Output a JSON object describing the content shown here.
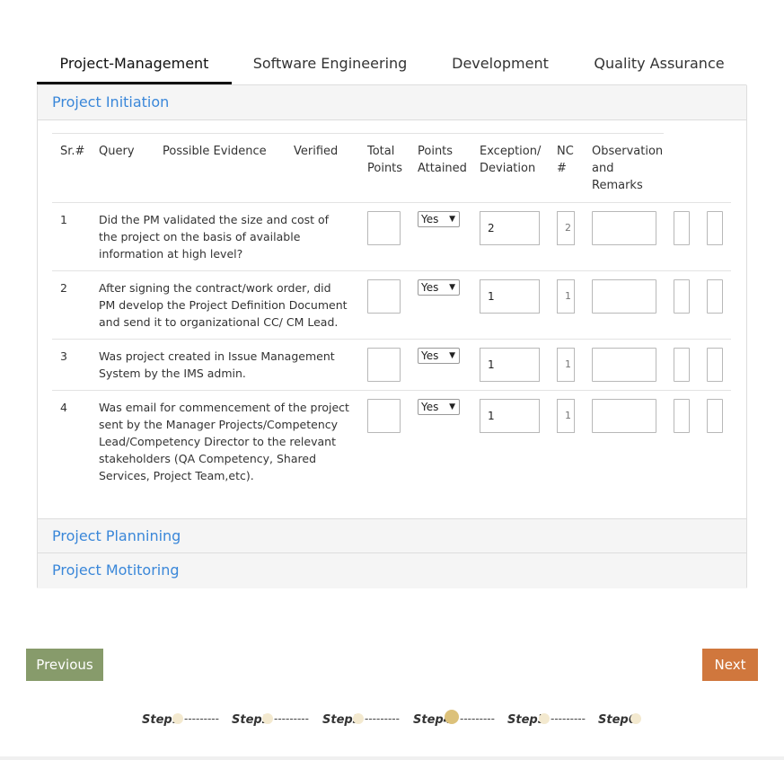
{
  "tabs": [
    "Project-Management",
    "Software Engineering",
    "Development",
    "Quality Assurance"
  ],
  "active_tab": 0,
  "sections": [
    "Project Initiation",
    "Project Plannining",
    "Project Motitoring"
  ],
  "table": {
    "headers": {
      "sr": "Sr.#",
      "query": "Query",
      "evidence": "Possible Evidence",
      "verified": "Verified",
      "total_points": [
        "Total",
        "Points"
      ],
      "points_attained": [
        "Points",
        "Attained"
      ],
      "exception": [
        "Exception/",
        "Deviation"
      ],
      "nc": [
        "NC",
        "#"
      ],
      "observation": [
        "Observation",
        "and",
        "Remarks"
      ]
    },
    "rows": [
      {
        "sr": "1",
        "query": "Did the PM validated the size and cost of the project on the basis of available information at high level?",
        "select": "Yes",
        "exception": "2",
        "nc": "2"
      },
      {
        "sr": "2",
        "query": "After signing the contract/work order, did PM develop the Project Definition Document and send it to organizational CC/ CM Lead.",
        "select": "Yes",
        "exception": "1",
        "nc": "1"
      },
      {
        "sr": "3",
        "query": "Was project created in Issue Management System by the IMS admin.",
        "select": "Yes",
        "exception": "1",
        "nc": "1"
      },
      {
        "sr": "4",
        "query": "Was email for commencement of the project sent by the Manager Projects/Competency Lead/Competency Director to the relevant stakeholders (QA Competency, Shared Services, Project Team,etc).",
        "select": "Yes",
        "exception": "1",
        "nc": "1"
      }
    ]
  },
  "buttons": {
    "previous": "Previous",
    "next": "Next"
  },
  "steps": [
    "Step1",
    "Step2",
    "Step3",
    "Step4",
    "Step5",
    "Step6"
  ],
  "active_step": 3,
  "step_separator": "---------",
  "colors": {
    "link": "#3a87d9",
    "previous_button": "#879b6b",
    "next_button": "#d0773d",
    "step_dot": "#f3e9cf",
    "step_dot_active": "#dcc17a"
  }
}
